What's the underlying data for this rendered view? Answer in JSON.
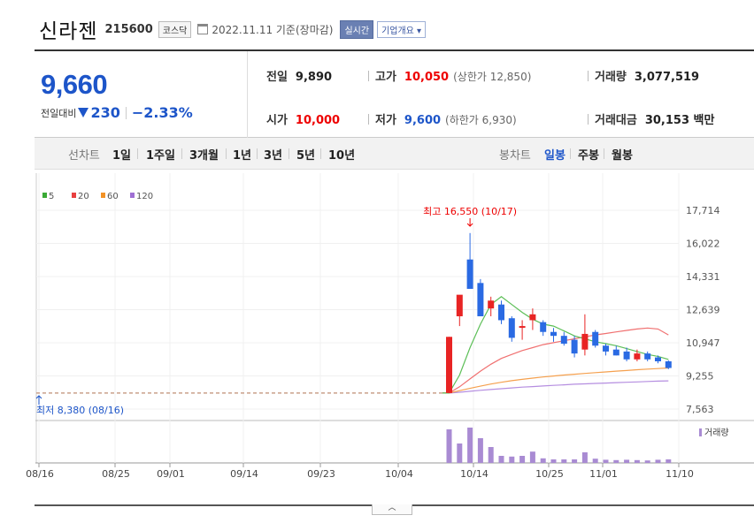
{
  "header": {
    "name": "신라젠",
    "code": "215600",
    "market": "코스닥",
    "date": "2022.11.11  기준(장마감)",
    "realtime_label": "실시간",
    "company_label": "기업개요 ▾"
  },
  "price": {
    "current": "9,660",
    "change_label": "전일대비",
    "change": "230",
    "change_pct": "−2.33%"
  },
  "stats": {
    "prev_label": "전일",
    "prev": "9,890",
    "high_label": "고가",
    "high": "10,050",
    "high_limit": "(상한가 12,850)",
    "volume_label": "거래량",
    "volume": "3,077,519",
    "open_label": "시가",
    "open": "10,000",
    "low_label": "저가",
    "low": "9,600",
    "low_limit": "(하한가 6,930)",
    "amount_label": "거래대금",
    "amount": "30,153 백만"
  },
  "tabs": {
    "line_chart": "선차트",
    "periods": [
      "1일",
      "1주일",
      "3개월",
      "1년",
      "3년",
      "5년",
      "10년"
    ],
    "candle_chart": "봉차트",
    "candle_periods": [
      "일봉",
      "주봉",
      "월봉"
    ]
  },
  "chart_data": {
    "type": "candlestick",
    "legend": [
      {
        "name": "5",
        "color": "#3aaa35"
      },
      {
        "name": "20",
        "color": "#e84040"
      },
      {
        "name": "60",
        "color": "#f29226"
      },
      {
        "name": "120",
        "color": "#9f6fd4"
      }
    ],
    "y_ticks": [
      "17,714",
      "16,022",
      "14,331",
      "12,639",
      "10,947",
      "9,255",
      "7,563"
    ],
    "ylim": [
      7563,
      17714
    ],
    "x_ticks": [
      "08/16",
      "08/25",
      "09/01",
      "09/14",
      "09/23",
      "10/04",
      "10/14",
      "10/25",
      "11/01",
      "11/10"
    ],
    "max_label": "최고 16,550 (10/17)",
    "min_label": "최저 8,380 (08/16)",
    "volume_label": "거래량",
    "flat_price": 8380,
    "candles": [
      {
        "o": 8380,
        "h": 11250,
        "l": 8380,
        "c": 11250
      },
      {
        "o": 12300,
        "h": 12600,
        "l": 11800,
        "c": 13400
      },
      {
        "o": 15200,
        "h": 16550,
        "l": 14700,
        "c": 13700
      },
      {
        "o": 14000,
        "h": 14200,
        "l": 12500,
        "c": 12300
      },
      {
        "o": 12700,
        "h": 13300,
        "l": 12300,
        "c": 13100
      },
      {
        "o": 12900,
        "h": 13100,
        "l": 11900,
        "c": 12100
      },
      {
        "o": 12200,
        "h": 12300,
        "l": 11000,
        "c": 11200
      },
      {
        "o": 11800,
        "h": 12100,
        "l": 11100,
        "c": 11800
      },
      {
        "o": 12100,
        "h": 12700,
        "l": 11600,
        "c": 12400
      },
      {
        "o": 12000,
        "h": 12100,
        "l": 11300,
        "c": 11500
      },
      {
        "o": 11500,
        "h": 11700,
        "l": 11000,
        "c": 11300
      },
      {
        "o": 11300,
        "h": 11500,
        "l": 10800,
        "c": 10900
      },
      {
        "o": 11100,
        "h": 11300,
        "l": 10200,
        "c": 10400
      },
      {
        "o": 10600,
        "h": 12400,
        "l": 10300,
        "c": 11400
      },
      {
        "o": 11500,
        "h": 11600,
        "l": 10700,
        "c": 10800
      },
      {
        "o": 10800,
        "h": 10900,
        "l": 10300,
        "c": 10500
      },
      {
        "o": 10600,
        "h": 10800,
        "l": 10300,
        "c": 10300
      },
      {
        "o": 10500,
        "h": 10700,
        "l": 10000,
        "c": 10100
      },
      {
        "o": 10100,
        "h": 10600,
        "l": 10000,
        "c": 10400
      },
      {
        "o": 10400,
        "h": 10500,
        "l": 10000,
        "c": 10100
      },
      {
        "o": 10200,
        "h": 10300,
        "l": 9900,
        "c": 10000
      },
      {
        "o": 10000,
        "h": 10050,
        "l": 9600,
        "c": 9660
      }
    ],
    "ma5": [
      8380,
      9300,
      10700,
      11900,
      12900,
      13300,
      12900,
      12500,
      12150,
      11900,
      11800,
      11550,
      11300,
      11150,
      11000,
      10900,
      10800,
      10650,
      10500,
      10350,
      10250,
      10100
    ],
    "ma20": [
      8380,
      8700,
      9100,
      9500,
      9850,
      10150,
      10350,
      10550,
      10700,
      10850,
      10950,
      11050,
      11150,
      11250,
      11350,
      11420,
      11500,
      11580,
      11650,
      11700,
      11650,
      11350
    ],
    "ma60": [
      8380,
      8500,
      8620,
      8730,
      8840,
      8930,
      9010,
      9080,
      9140,
      9200,
      9250,
      9300,
      9340,
      9380,
      9420,
      9460,
      9500,
      9530,
      9570,
      9600,
      9630,
      9660
    ],
    "ma120": [
      8380,
      8420,
      8470,
      8520,
      8560,
      8600,
      8640,
      8680,
      8710,
      8740,
      8770,
      8800,
      8830,
      8850,
      8870,
      8890,
      8910,
      8930,
      8950,
      8970,
      8990,
      9000
    ],
    "volumes": [
      0.95,
      0.55,
      1.0,
      0.7,
      0.45,
      0.2,
      0.18,
      0.2,
      0.32,
      0.13,
      0.1,
      0.1,
      0.1,
      0.3,
      0.12,
      0.09,
      0.08,
      0.09,
      0.08,
      0.07,
      0.09,
      0.1
    ]
  }
}
